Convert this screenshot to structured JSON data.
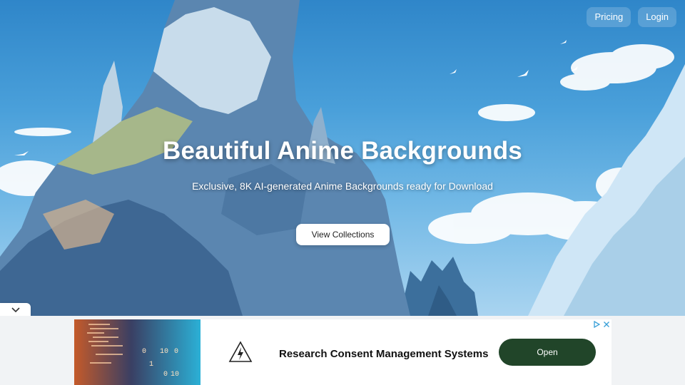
{
  "nav": {
    "pricing": "Pricing",
    "login": "Login"
  },
  "hero": {
    "title": "Beautiful Anime Backgrounds",
    "subtitle": "Exclusive, 8K AI-generated Anime Backgrounds ready for Download",
    "cta": "View Collections"
  },
  "ad": {
    "headline": "Research Consent Management Systems",
    "open_label": "Open",
    "image_digits": [
      "0",
      "10",
      "0",
      "1",
      "0",
      "10"
    ],
    "logo_icon": "lightning-triangle-icon",
    "choices": [
      "play-icon",
      "close-icon"
    ]
  },
  "colors": {
    "sky": "#3a93d1",
    "ad_button": "#214529"
  }
}
